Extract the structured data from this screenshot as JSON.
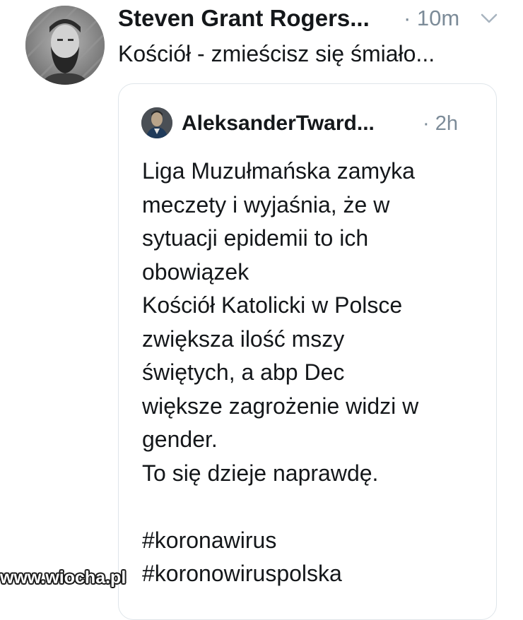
{
  "reply": {
    "author": "Steven Grant Rogers...",
    "timestamp": "· 10m",
    "text": "Kościół - zmieścisz się śmiało...",
    "avatar_icon": "bearded-man-avatar",
    "menu_icon": "chevron-down-icon"
  },
  "quoted": {
    "author": "AleksanderTward...",
    "timestamp": "· 2h",
    "avatar_icon": "profile-avatar",
    "lines": [
      "Liga Muzułmańska zamyka",
      "meczety i wyjaśnia, że w",
      "sytuacji epidemii to ich",
      "obowiązek",
      "Kościół Katolicki w Polsce",
      "zwiększa ilość mszy",
      "świętych, a abp Dec",
      "większe zagrożenie widzi w",
      "gender.",
      "To się dzieje naprawdę."
    ],
    "hashtags": [
      "#koronawirus",
      "#koronowiruspolska"
    ]
  },
  "watermark": "www.wiocha.pl",
  "colors": {
    "text": "#14171a",
    "muted": "#7c8b98",
    "border": "#dfe5ea"
  }
}
